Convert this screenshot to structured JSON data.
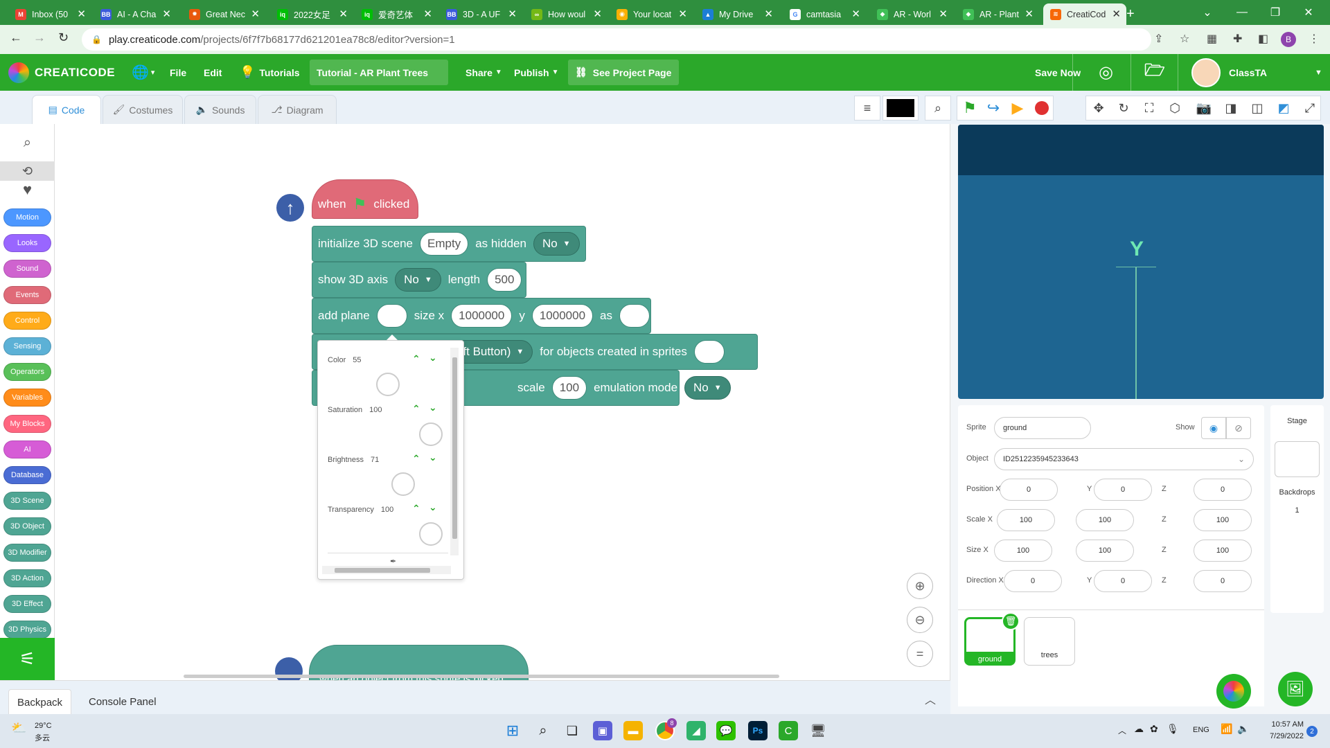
{
  "browser": {
    "tabs": [
      {
        "title": "Inbox (50",
        "icon": "gmail-icon",
        "color": "#ea4335",
        "glyph": "M"
      },
      {
        "title": "AI - A Cha",
        "icon": "bb-icon",
        "color": "#3b5bdb",
        "glyph": "BB"
      },
      {
        "title": "Great Nec",
        "icon": "sun-icon",
        "color": "#e8590c",
        "glyph": "✹"
      },
      {
        "title": "2022女足",
        "icon": "iqiyi-icon",
        "color": "#00be06",
        "glyph": "iq"
      },
      {
        "title": "爱奇艺体",
        "icon": "iqiyi-icon",
        "color": "#00be06",
        "glyph": "iq"
      },
      {
        "title": "3D - A UF",
        "icon": "bb-icon",
        "color": "#3b5bdb",
        "glyph": "BB"
      },
      {
        "title": "How woul",
        "icon": "link-icon",
        "color": "#74b816",
        "glyph": "∞"
      },
      {
        "title": "Your locat",
        "icon": "maps-icon",
        "color": "#fab005",
        "glyph": "◉"
      },
      {
        "title": "My Drive",
        "icon": "drive-icon",
        "color": "#1c7ed6",
        "glyph": "▲"
      },
      {
        "title": "camtasia",
        "icon": "google-icon",
        "color": "#ffffff",
        "glyph": "G"
      },
      {
        "title": "AR - Worl",
        "icon": "marker-icon",
        "color": "#40c057",
        "glyph": "◆"
      },
      {
        "title": "AR - Plant",
        "icon": "marker-icon",
        "color": "#40c057",
        "glyph": "◆"
      },
      {
        "title": "CreatiCod",
        "icon": "creaticode-icon",
        "color": "#f76707",
        "glyph": "≋"
      }
    ],
    "new_tab": "+",
    "url_domain": "play.creaticode.com",
    "url_path": "/projects/6f7f7b68177d621201ea78c8/editor?version=1",
    "profile_initial": "B"
  },
  "app": {
    "logo": "CREATICODE",
    "menu": {
      "file": "File",
      "edit": "Edit",
      "tutorials": "Tutorials",
      "tutorial_name": "Tutorial - AR Plant Trees",
      "share": "Share",
      "publish": "Publish",
      "see_project": "See Project Page",
      "save": "Save Now",
      "user": "ClassTA"
    },
    "editor_tabs": {
      "code": "Code",
      "costumes": "Costumes",
      "sounds": "Sounds",
      "diagram": "Diagram"
    }
  },
  "categories": [
    {
      "label": "Motion",
      "color": "#4c97ff"
    },
    {
      "label": "Looks",
      "color": "#9966ff"
    },
    {
      "label": "Sound",
      "color": "#cf63cf"
    },
    {
      "label": "Events",
      "color": "#e06a78"
    },
    {
      "label": "Control",
      "color": "#ffab19"
    },
    {
      "label": "Sensing",
      "color": "#5cb1d6"
    },
    {
      "label": "Operators",
      "color": "#59c059"
    },
    {
      "label": "Variables",
      "color": "#ff8c1a"
    },
    {
      "label": "My Blocks",
      "color": "#ff6680"
    },
    {
      "label": "AI",
      "color": "#d65cd6"
    },
    {
      "label": "Database",
      "color": "#4a6cd4"
    },
    {
      "label": "3D Scene",
      "color": "#4fa593"
    },
    {
      "label": "3D Object",
      "color": "#4fa593"
    },
    {
      "label": "3D Modifier",
      "color": "#4fa593"
    },
    {
      "label": "3D Action",
      "color": "#4fa593"
    },
    {
      "label": "3D Effect",
      "color": "#4fa593"
    },
    {
      "label": "3D Physics",
      "color": "#4fa593"
    }
  ],
  "blocks": {
    "hat": {
      "when": "when",
      "clicked": "clicked"
    },
    "init": {
      "text1": "initialize 3D scene",
      "scene": "Empty",
      "text2": "as hidden",
      "hidden": "No"
    },
    "axis": {
      "text1": "show 3D axis",
      "value": "No",
      "text2": "length",
      "length": "500"
    },
    "plane": {
      "text1": "add plane",
      "text2": "size x",
      "x": "1000000",
      "text3": "y",
      "y": "1000000",
      "text4": "as"
    },
    "row4": {
      "dd": "er (Left Button)",
      "text": "for objects created in sprites"
    },
    "row5": {
      "text1": "scale",
      "scale": "100",
      "text2": "emulation mode",
      "mode": "No"
    },
    "bottom_hat": "when an object from this sprite is picked"
  },
  "color_picker": {
    "rows": [
      {
        "label": "Color",
        "value": "55"
      },
      {
        "label": "Saturation",
        "value": "100"
      },
      {
        "label": "Brightness",
        "value": "71"
      },
      {
        "label": "Transparency",
        "value": "100"
      }
    ]
  },
  "bottom_panel": {
    "backpack": "Backpack",
    "console": "Console Panel"
  },
  "stage": {
    "axis_label": "Y",
    "stage_label": "Stage",
    "backdrops_label": "Backdrops",
    "backdrops_count": "1"
  },
  "sprite": {
    "sprite_label": "Sprite",
    "name": "ground",
    "show_label": "Show",
    "object_label": "Object",
    "object_id": "ID2512235945233643",
    "position": {
      "label": "Position X",
      "x": "0",
      "y": "0",
      "z": "0"
    },
    "scale": {
      "label": "Scale X",
      "x": "100",
      "y": "100",
      "z": "100"
    },
    "size": {
      "label": "Size X",
      "x": "100",
      "y": "100",
      "z": "100"
    },
    "direction": {
      "label": "Direction X",
      "x": "0",
      "y": "0",
      "z": "0"
    },
    "y_label": "Y",
    "z_label": "Z",
    "sprites": [
      "ground",
      "trees"
    ]
  },
  "taskbar": {
    "weather_temp": "29°C",
    "weather_desc": "多云",
    "lang": "ENG",
    "time": "10:57 AM",
    "date": "7/29/2022",
    "notif": "2",
    "chrome_badge": "8"
  }
}
